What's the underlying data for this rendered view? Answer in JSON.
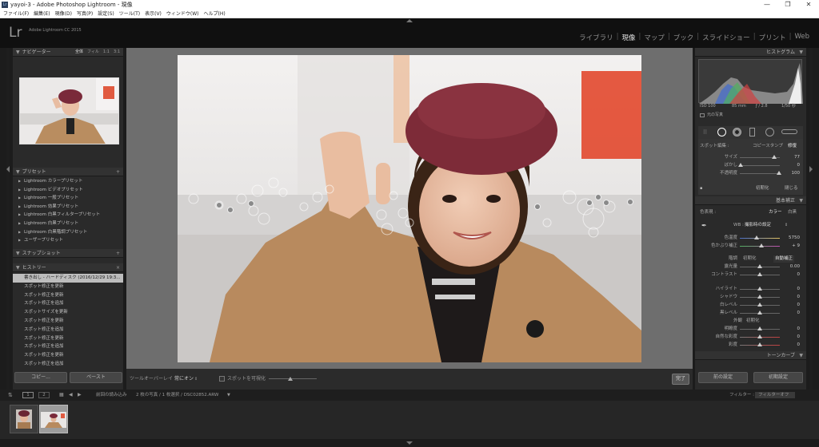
{
  "titlebar": {
    "title": "yayoi-3 - Adobe Photoshop Lightroom - 現像",
    "minimize": "—",
    "maximize": "❐",
    "close": "✕"
  },
  "menubar": [
    "ファイル(F)",
    "編集(E)",
    "現像(D)",
    "写真(P)",
    "設定(S)",
    "ツール(T)",
    "表示(V)",
    "ウィンドウ(W)",
    "ヘルプ(H)"
  ],
  "identity": {
    "logo": "Lr",
    "product": "Adobe Lightroom CC 2015",
    "modules": [
      "ライブラリ",
      "現像",
      "マップ",
      "ブック",
      "スライドショー",
      "プリント",
      "Web"
    ],
    "active_module": "現像"
  },
  "left": {
    "navigator": {
      "title": "ナビゲーター",
      "tabs": [
        "全体",
        "フィル",
        "1:1",
        "3:1"
      ]
    },
    "presets": {
      "title": "プリセット",
      "items": [
        "Lightroom カラープリセット",
        "Lightroom ビデオプリセット",
        "Lightroom 一般プリセット",
        "Lightroom 効果プリセット",
        "Lightroom 白黒フィルタープリセット",
        "Lightroom 白黒プリセット",
        "Lightroom 白黒階調プリセット",
        "ユーザープリセット"
      ]
    },
    "snapshots": {
      "title": "スナップショット"
    },
    "history": {
      "title": "ヒストリー",
      "items": [
        "書き出し - ハードディスク (2016/12/29 19:3...",
        "スポット修正を更新",
        "スポット修正を更新",
        "スポット修正を追加",
        "スポットサイズを更新",
        "スポット修正を更新",
        "スポット修正を追加",
        "スポット修正を更新",
        "スポット修正を追加",
        "スポット修正を更新",
        "スポット修正を追加"
      ]
    },
    "copy_button": "コピー...",
    "paste_button": "ペースト"
  },
  "toolbar": {
    "overlay_label": "ツールオーバーレイ :",
    "overlay_value": "常にオン",
    "visualize_label": "スポットを可視化",
    "done_button": "完了"
  },
  "right": {
    "histogram": {
      "title": "ヒストグラム",
      "iso": "ISO 100",
      "focal": "85 mm",
      "aperture": "ƒ / 2.8",
      "shutter": "1/50 秒",
      "original": "元の写真"
    },
    "spot": {
      "label": "スポット編集 :",
      "clone": "コピースタンプ",
      "heal": "修復",
      "sliders": [
        {
          "label": "サイズ",
          "value": "77",
          "knob": 0.85
        },
        {
          "label": "ぼかし",
          "value": "0",
          "knob": 0.02
        },
        {
          "label": "不透明度",
          "value": "100",
          "knob": 0.98
        }
      ],
      "reset": "初期化",
      "close": "閉じる"
    },
    "basic": {
      "title": "基本補正",
      "treatment_label": "色表現 :",
      "color": "カラー",
      "bw": "白黒",
      "wb_label": "WB :",
      "wb_value": "撮影時の設定",
      "sliders1": [
        {
          "label": "色温度",
          "value": "5750",
          "knob": 0.42
        },
        {
          "label": "色かぶり補正",
          "value": "+ 9",
          "knob": 0.53
        }
      ],
      "tone_label": "階調",
      "tone_reset": "初期化",
      "auto": "自動補正",
      "sliders2": [
        {
          "label": "露光量",
          "value": "0.00",
          "knob": 0.5
        },
        {
          "label": "コントラスト",
          "value": "0",
          "knob": 0.5
        },
        {
          "label": "ハイライト",
          "value": "0",
          "knob": 0.5
        },
        {
          "label": "シャドウ",
          "value": "0",
          "knob": 0.5
        },
        {
          "label": "白レベル",
          "value": "0",
          "knob": 0.5
        },
        {
          "label": "黒レベル",
          "value": "0",
          "knob": 0.5
        }
      ],
      "presence_label": "外観",
      "presence_reset": "初期化",
      "sliders3": [
        {
          "label": "明瞭度",
          "value": "0",
          "knob": 0.5
        },
        {
          "label": "自然な彩度",
          "value": "0",
          "knob": 0.5
        },
        {
          "label": "彩度",
          "value": "0",
          "knob": 0.5
        }
      ]
    },
    "tonecurve": {
      "title": "トーンカーブ"
    },
    "previous_button": "前の設定",
    "reset_button": "初期設定"
  },
  "filmbar": {
    "view1": "1",
    "view2": "2",
    "source": "前回の読み込み",
    "count": "2 枚の写真 / 1 枚選択 / DSC02852.ARW",
    "filter_label": "フィルター :",
    "filter_value": "フィルターオフ"
  }
}
